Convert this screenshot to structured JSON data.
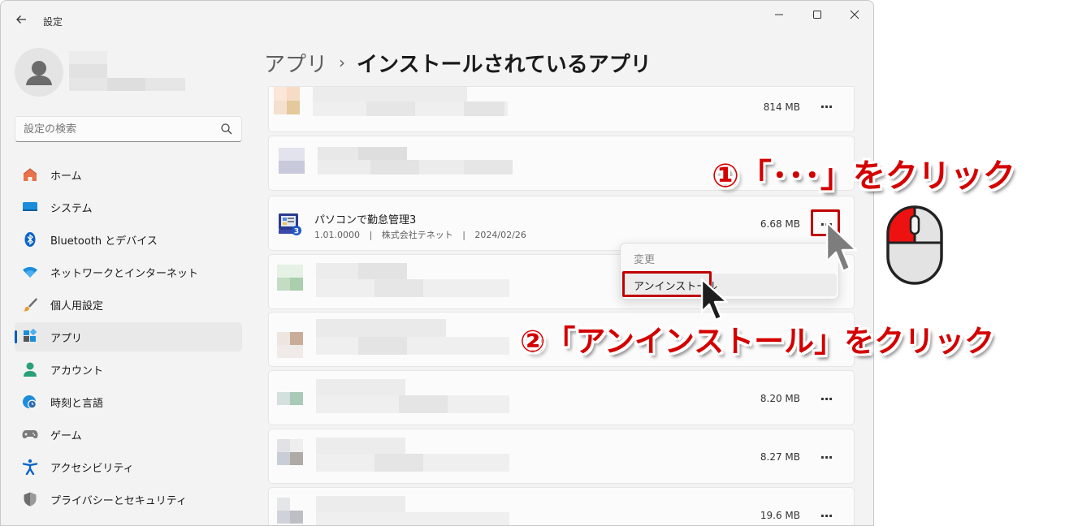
{
  "window": {
    "title": "設定",
    "controls": {
      "minimize": "minimize-icon",
      "maximize": "maximize-icon",
      "close": "close-icon"
    }
  },
  "search": {
    "placeholder": "設定の検索"
  },
  "nav": {
    "items": [
      {
        "label": "ホーム",
        "icon": "home-icon"
      },
      {
        "label": "システム",
        "icon": "display-icon"
      },
      {
        "label": "Bluetooth とデバイス",
        "icon": "bluetooth-icon"
      },
      {
        "label": "ネットワークとインターネット",
        "icon": "wifi-icon"
      },
      {
        "label": "個人用設定",
        "icon": "brush-icon"
      },
      {
        "label": "アプリ",
        "icon": "apps-icon",
        "selected": true
      },
      {
        "label": "アカウント",
        "icon": "person-icon"
      },
      {
        "label": "時刻と言語",
        "icon": "globe-clock-icon"
      },
      {
        "label": "ゲーム",
        "icon": "gamepad-icon"
      },
      {
        "label": "アクセシビリティ",
        "icon": "accessibility-icon"
      },
      {
        "label": "プライバシーとセキュリティ",
        "icon": "shield-icon"
      }
    ]
  },
  "breadcrumb": {
    "parent": "アプリ",
    "separator": "›",
    "current": "インストールされているアプリ"
  },
  "apps": [
    {
      "size": "814 MB"
    },
    {
      "size": ""
    },
    {
      "name": "パソコンで勤怠管理3",
      "version": "1.01.0000",
      "publisher": "株式会社テネット",
      "date": "2024/02/26",
      "meta_sep": "|",
      "size": "6.68 MB",
      "icon": "timecard-app-icon"
    },
    {
      "size": ""
    },
    {
      "size": ""
    },
    {
      "size": "8.20 MB"
    },
    {
      "size": "8.27 MB"
    },
    {
      "size": "19.6 MB"
    }
  ],
  "more_label": "···",
  "context_menu": {
    "modify": "変更",
    "uninstall": "アンインストール"
  },
  "annotations": {
    "step1": "①「･･･」をクリック",
    "step2": "②「アンインストール」をクリック"
  },
  "colors": {
    "accent": "#005fb8",
    "annotation_red": "#d40000",
    "selection": "#e9e9e9"
  }
}
